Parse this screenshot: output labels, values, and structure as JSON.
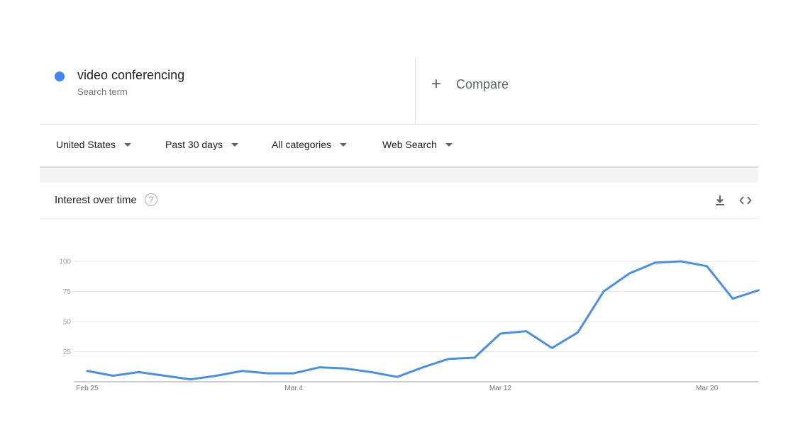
{
  "term": {
    "title": "video conferencing",
    "subtitle": "Search term",
    "color": "#4285f4"
  },
  "compare": {
    "label": "Compare",
    "icon": "plus-icon"
  },
  "filters": [
    {
      "name": "region",
      "label": "United States"
    },
    {
      "name": "time-range",
      "label": "Past 30 days"
    },
    {
      "name": "category",
      "label": "All categories"
    },
    {
      "name": "search-type",
      "label": "Web Search"
    }
  ],
  "card": {
    "title": "Interest over time",
    "help_icon": "help-icon",
    "download_icon": "download-icon",
    "embed_icon": "embed-code-icon"
  },
  "chart_data": {
    "type": "line",
    "title": "",
    "xlabel": "",
    "ylabel": "",
    "ylim": [
      0,
      100
    ],
    "yticks": [
      25,
      50,
      75,
      100
    ],
    "x_tick_labels": [
      {
        "label": "Feb 25",
        "index": 0
      },
      {
        "label": "Mar 4",
        "index": 8
      },
      {
        "label": "Mar 12",
        "index": 16
      },
      {
        "label": "Mar 20",
        "index": 24
      }
    ],
    "grid": true,
    "color": "#4a90e2",
    "series": [
      {
        "name": "video conferencing",
        "values": [
          9,
          5,
          8,
          5,
          2,
          5,
          9,
          7,
          7,
          12,
          11,
          8,
          4,
          12,
          19,
          20,
          40,
          42,
          28,
          41,
          75,
          90,
          99,
          100,
          96,
          69,
          76
        ]
      }
    ]
  }
}
